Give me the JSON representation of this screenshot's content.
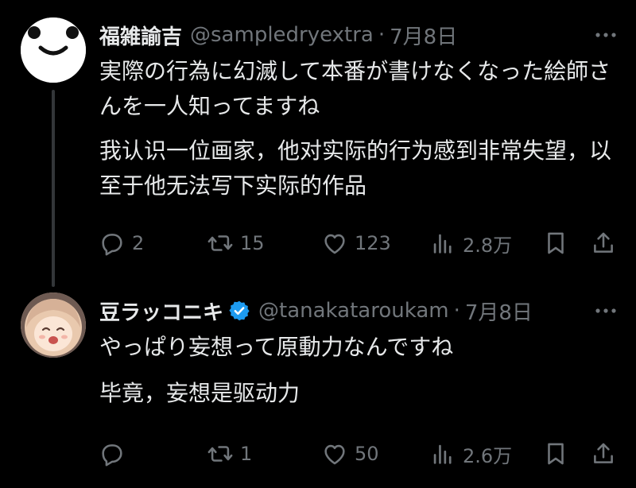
{
  "tweets": [
    {
      "display_name": "福雑諭吉",
      "handle": "@sampledryextra",
      "date": "7月8日",
      "text_ja": "実際の行為に幻滅して本番が書けなくなった絵師さんを一人知ってますね",
      "text_zh": "我认识一位画家，他对实际的行为感到非常失望，以至于他无法写下实际的作品",
      "replies": "2",
      "retweets": "15",
      "likes": "123",
      "views": "2.8万",
      "verified": false
    },
    {
      "display_name": "豆ラッコニキ",
      "handle": "@tanakataroukam",
      "date": "7月8日",
      "text_ja": "やっぱり妄想って原動力なんですね",
      "text_zh": "毕竟，妄想是驱动力",
      "replies": "",
      "retweets": "1",
      "likes": "50",
      "views": "2.6万",
      "verified": true
    }
  ],
  "separator": "·",
  "colors": {
    "background": "#000000",
    "text": "#e7e9ea",
    "muted": "#71767b",
    "verified": "#1d9bf0",
    "thread_line": "#333639"
  },
  "icons": [
    "smiley-avatar",
    "anime-avatar",
    "verified-badge-icon",
    "more-icon",
    "reply-icon",
    "retweet-icon",
    "like-icon",
    "views-icon",
    "bookmark-icon",
    "share-icon"
  ]
}
